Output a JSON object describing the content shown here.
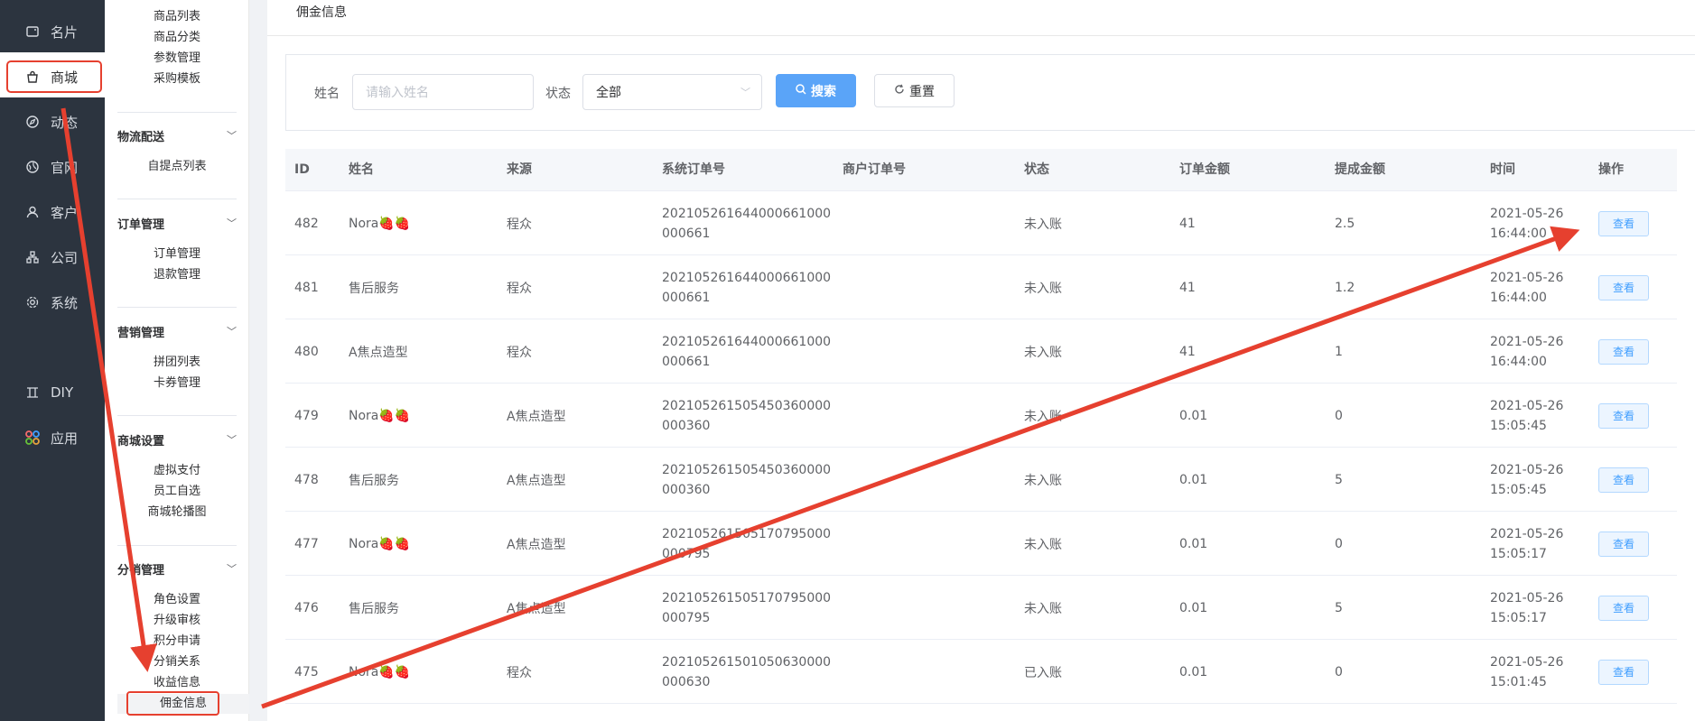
{
  "rail": {
    "items": [
      {
        "label": "名片",
        "icon": "card-icon"
      },
      {
        "label": "商城",
        "icon": "shop-bag-icon"
      },
      {
        "label": "动态",
        "icon": "compass-icon"
      },
      {
        "label": "官网",
        "icon": "globe-icon"
      },
      {
        "label": "客户",
        "icon": "user-icon"
      },
      {
        "label": "公司",
        "icon": "org-icon"
      },
      {
        "label": "系统",
        "icon": "gear-icon"
      },
      {
        "label": "DIY",
        "icon": "diy-icon"
      },
      {
        "label": "应用",
        "icon": "apps-icon"
      }
    ]
  },
  "submenu": {
    "top_items": [
      "商品列表",
      "商品分类",
      "参数管理",
      "采购模板"
    ],
    "groups": [
      {
        "title": "物流配送",
        "items": [
          "自提点列表"
        ]
      },
      {
        "title": "订单管理",
        "items": [
          "订单管理",
          "退款管理"
        ]
      },
      {
        "title": "营销管理",
        "items": [
          "拼团列表",
          "卡券管理"
        ]
      },
      {
        "title": "商城设置",
        "items": [
          "虚拟支付",
          "员工自选",
          "商城轮播图"
        ]
      },
      {
        "title": "分销管理",
        "items": [
          "角色设置",
          "升级审核",
          "积分申请",
          "分销关系",
          "收益信息",
          "佣金信息"
        ]
      }
    ]
  },
  "header": {
    "title": "佣金信息"
  },
  "filter": {
    "name_label": "姓名",
    "name_placeholder": "请输入姓名",
    "status_label": "状态",
    "status_value": "全部",
    "search_label": "搜索",
    "reset_label": "重置"
  },
  "table": {
    "columns": [
      "ID",
      "姓名",
      "来源",
      "系统订单号",
      "商户订单号",
      "状态",
      "订单金额",
      "提成金额",
      "时间",
      "操作"
    ],
    "rows": [
      {
        "id": "482",
        "name": "Nora🍓🍓",
        "source": "程众",
        "sys_order": "202105261644000661000000661",
        "merchant_order": "",
        "status": "未入账",
        "amount": "41",
        "commission": "2.5",
        "time": "2021-05-26 16:44:00",
        "action": "查看"
      },
      {
        "id": "481",
        "name": "售后服务",
        "source": "程众",
        "sys_order": "202105261644000661000000661",
        "merchant_order": "",
        "status": "未入账",
        "amount": "41",
        "commission": "1.2",
        "time": "2021-05-26 16:44:00",
        "action": "查看"
      },
      {
        "id": "480",
        "name": "A焦点造型",
        "source": "程众",
        "sys_order": "202105261644000661000000661",
        "merchant_order": "",
        "status": "未入账",
        "amount": "41",
        "commission": "1",
        "time": "2021-05-26 16:44:00",
        "action": "查看"
      },
      {
        "id": "479",
        "name": "Nora🍓🍓",
        "source": "A焦点造型",
        "sys_order": "202105261505450360000000360",
        "merchant_order": "",
        "status": "未入账",
        "amount": "0.01",
        "commission": "0",
        "time": "2021-05-26 15:05:45",
        "action": "查看"
      },
      {
        "id": "478",
        "name": "售后服务",
        "source": "A焦点造型",
        "sys_order": "202105261505450360000000360",
        "merchant_order": "",
        "status": "未入账",
        "amount": "0.01",
        "commission": "5",
        "time": "2021-05-26 15:05:45",
        "action": "查看"
      },
      {
        "id": "477",
        "name": "Nora🍓🍓",
        "source": "A焦点造型",
        "sys_order": "202105261505170795000000795",
        "merchant_order": "",
        "status": "未入账",
        "amount": "0.01",
        "commission": "0",
        "time": "2021-05-26 15:05:17",
        "action": "查看"
      },
      {
        "id": "476",
        "name": "售后服务",
        "source": "A焦点造型",
        "sys_order": "202105261505170795000000795",
        "merchant_order": "",
        "status": "未入账",
        "amount": "0.01",
        "commission": "5",
        "time": "2021-05-26 15:05:17",
        "action": "查看"
      },
      {
        "id": "475",
        "name": "Nora🍓🍓",
        "source": "程众",
        "sys_order": "202105261501050630000000630",
        "merchant_order": "",
        "status": "已入账",
        "amount": "0.01",
        "commission": "0",
        "time": "2021-05-26 15:01:45",
        "action": "查看"
      }
    ]
  },
  "colors": {
    "rail_bg": "#2c343f",
    "primary": "#5aa4f8",
    "annotation": "#e6402f"
  }
}
